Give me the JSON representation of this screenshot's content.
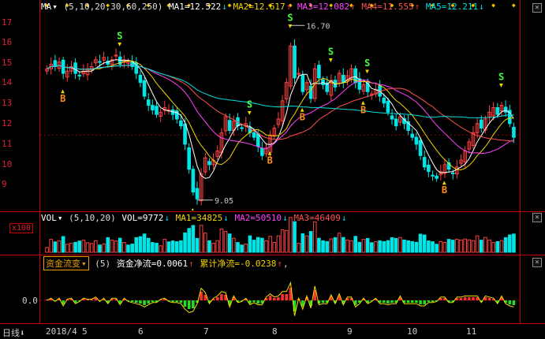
{
  "main": {
    "indicator": "MA",
    "params": "(5,10,20,30,60,250)",
    "ma_labels": [
      {
        "text": "MA1=12.522",
        "arrow": "↓",
        "color": "#ffffff"
      },
      {
        "text": "MA2=12.617",
        "arrow": "↑",
        "color": "#f5d400"
      },
      {
        "text": "MA3=12.082",
        "arrow": "↑",
        "color": "#ff40ff"
      },
      {
        "text": "MA4=11.555",
        "arrow": "↑",
        "color": "#ff5050"
      },
      {
        "text": "MA5=12.211",
        "arrow": "↓",
        "color": "#00e0e0"
      }
    ],
    "y_ticks": [
      "17",
      "16",
      "15",
      "14",
      "13",
      "12",
      "11",
      "10",
      "9"
    ],
    "high_label": "16.70",
    "low_label": "9.05",
    "buy_mark": "B",
    "sell_mark": "S"
  },
  "volume": {
    "indicator": "VOL",
    "params": "(5,10,20)",
    "labels": [
      {
        "text": "VOL=9772",
        "arrow": "↓",
        "color": "#ffffff"
      },
      {
        "text": "MA1=34825",
        "arrow": "↓",
        "color": "#f5d400"
      },
      {
        "text": "MA2=50510",
        "arrow": "↓",
        "color": "#ff40ff"
      },
      {
        "text": "MA3=46409",
        "arrow": "↓",
        "color": "#ff5050"
      }
    ],
    "unit": "x100"
  },
  "flow": {
    "indicator": "资金流变",
    "params": "(5)",
    "net": "资金净流=0.0061",
    "net_arrow": "↑",
    "cum": "累计净流=-0.0238",
    "cum_arrow": "↑",
    "zero": "0.0"
  },
  "xaxis": {
    "period": "日线",
    "labels": [
      "2018/4",
      "5",
      "6",
      "7",
      "8",
      "9",
      "10",
      "11"
    ]
  },
  "chart_data": {
    "type": "candlestick",
    "ylim": [
      8.8,
      17.4
    ],
    "closes": [
      14.8,
      15.0,
      14.9,
      15.1,
      14.6,
      14.7,
      14.9,
      14.6,
      14.5,
      14.7,
      14.8,
      14.9,
      15.2,
      15.1,
      15.3,
      15.0,
      15.2,
      15.4,
      15.0,
      15.2,
      15.1,
      14.9,
      14.6,
      14.2,
      13.6,
      13.2,
      13.0,
      12.8,
      12.9,
      13.1,
      13.0,
      12.8,
      12.6,
      12.3,
      11.5,
      10.4,
      9.4,
      9.1,
      10.2,
      10.9,
      10.6,
      10.8,
      11.2,
      12.0,
      12.7,
      12.1,
      12.5,
      12.3,
      12.2,
      12.4,
      12.0,
      11.8,
      11.4,
      11.0,
      11.3,
      11.9,
      12.2,
      12.6,
      13.4,
      14.2,
      15.8,
      14.4,
      14.6,
      13.8,
      14.2,
      13.5,
      14.8,
      14.4,
      14.1,
      13.8,
      14.3,
      14.0,
      14.6,
      14.2,
      14.5,
      14.8,
      14.2,
      13.9,
      14.1,
      13.8,
      13.7,
      13.9,
      13.6,
      13.3,
      12.9,
      12.6,
      12.3,
      12.7,
      12.4,
      12.1,
      11.8,
      11.5,
      11.0,
      10.5,
      10.3,
      10.1,
      10.0,
      10.3,
      10.6,
      10.4,
      10.2,
      10.5,
      10.8,
      11.2,
      11.6,
      12.0,
      12.4,
      12.2,
      12.6,
      12.9,
      13.1,
      12.8,
      13.2,
      12.9,
      12.4,
      11.8
    ]
  }
}
